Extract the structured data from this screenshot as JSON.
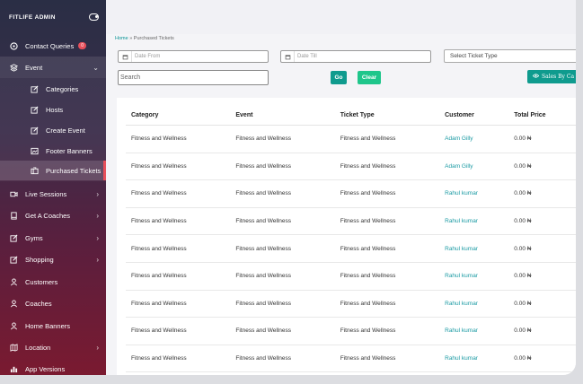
{
  "sidebar": {
    "brand": "FITLIFE ADMIN",
    "items": [
      {
        "label": "Contact Queries",
        "badge": "0",
        "icon": "chat-icon"
      },
      {
        "label": "Event",
        "icon": "layers-icon",
        "chevron": "⌄"
      },
      {
        "label": "Categories",
        "icon": "edit-icon"
      },
      {
        "label": "Hosts",
        "icon": "edit-icon"
      },
      {
        "label": "Create Event",
        "icon": "edit-icon"
      },
      {
        "label": "Footer Banners",
        "icon": "image-icon"
      },
      {
        "label": "Purchased Tickets",
        "icon": "ticket-icon"
      },
      {
        "label": "Live Sessions",
        "icon": "video-icon",
        "chevron": "›"
      },
      {
        "label": "Get A Coaches",
        "icon": "book-icon",
        "chevron": "›"
      },
      {
        "label": "Gyms",
        "icon": "edit-icon",
        "chevron": "›"
      },
      {
        "label": "Shopping",
        "icon": "edit-icon",
        "chevron": "›"
      },
      {
        "label": "Customers",
        "icon": "user-icon"
      },
      {
        "label": "Coaches",
        "icon": "user-icon"
      },
      {
        "label": "Home Banners",
        "icon": "user-icon"
      },
      {
        "label": "Location",
        "icon": "map-icon",
        "chevron": "›"
      },
      {
        "label": "App Versions",
        "icon": "bar-chart-icon"
      }
    ]
  },
  "breadcrumb": {
    "home": "Home",
    "sep": "»",
    "current": "Purchased Tickets"
  },
  "filters": {
    "date_from_placeholder": "Date From",
    "date_till_placeholder": "Date Till",
    "ticket_type_placeholder": "Select Ticket Type",
    "search_placeholder": "Search",
    "go_label": "Go",
    "clear_label": "Clear",
    "sales_label": "Sales By Ca"
  },
  "table": {
    "headers": [
      "Category",
      "Event",
      "Ticket Type",
      "Customer",
      "Total Price"
    ],
    "rows": [
      [
        "Fitness and Wellness",
        "Fitness and Wellness",
        "Fitness and Wellness",
        "Adam Gilly",
        "0.00 ₦"
      ],
      [
        "Fitness and Wellness",
        "Fitness and Wellness",
        "Fitness and Wellness",
        "Adam Gilly",
        "0.00 ₦"
      ],
      [
        "Fitness and Wellness",
        "Fitness and Wellness",
        "Fitness and Wellness",
        "Rahul kumar",
        "0.00 ₦"
      ],
      [
        "Fitness and Wellness",
        "Fitness and Wellness",
        "Fitness and Wellness",
        "Rahul kumar",
        "0.00 ₦"
      ],
      [
        "Fitness and Wellness",
        "Fitness and Wellness",
        "Fitness and Wellness",
        "Rahul kumar",
        "0.00 ₦"
      ],
      [
        "Fitness and Wellness",
        "Fitness and Wellness",
        "Fitness and Wellness",
        "Rahul kumar",
        "0.00 ₦"
      ],
      [
        "Fitness and Wellness",
        "Fitness and Wellness",
        "Fitness and Wellness",
        "Rahul kumar",
        "0.00 ₦"
      ],
      [
        "Fitness and Wellness",
        "Fitness and Wellness",
        "Fitness and Wellness",
        "Rahul kumar",
        "0.00 ₦"
      ],
      [
        "Fitness and Wellness",
        "Fitness and Wellness",
        "Fitness and Wellness",
        "Rahul kumar",
        "0.00 ₦"
      ]
    ]
  },
  "colors": {
    "accent": "#0f9b8e",
    "clear": "#1fc68b",
    "customer_link": "#1a9aa3",
    "badge": "#e8505b"
  }
}
